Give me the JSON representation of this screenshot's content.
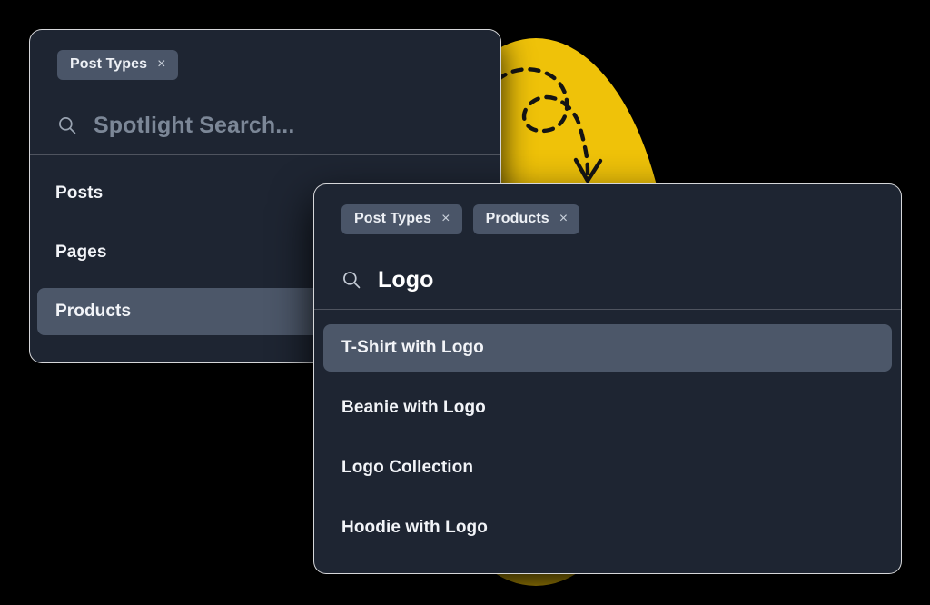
{
  "theme": {
    "page_background": "#000000",
    "panel_background": "#1E2532",
    "accent_yellow": "#EFC209",
    "chip_background": "#4A5568",
    "active_row_background": "#4C5769",
    "text_primary": "#F2F4F8",
    "text_placeholder": "#7C8797"
  },
  "back_panel": {
    "chips": [
      {
        "label": "Post Types",
        "close": "×"
      }
    ],
    "search": {
      "icon": "search-icon",
      "value": "",
      "placeholder": "Spotlight Search..."
    },
    "results": [
      {
        "label": "Posts",
        "active": false
      },
      {
        "label": "Pages",
        "active": false
      },
      {
        "label": "Products",
        "active": true
      }
    ]
  },
  "front_panel": {
    "chips": [
      {
        "label": "Post Types",
        "close": "×"
      },
      {
        "label": "Products",
        "close": "×"
      }
    ],
    "search": {
      "icon": "search-icon",
      "value": "Logo",
      "placeholder": "Spotlight Search..."
    },
    "results": [
      {
        "label": "T-Shirt with Logo",
        "active": true
      },
      {
        "label": "Beanie with Logo",
        "active": false
      },
      {
        "label": "Logo Collection",
        "active": false
      },
      {
        "label": "Hoodie with Logo",
        "active": false
      }
    ]
  },
  "decorations": {
    "circle": {
      "name": "yellow-circle",
      "color": "#EFC209"
    },
    "arrow": {
      "name": "dashed-curved-arrow",
      "color": "#141414"
    }
  }
}
